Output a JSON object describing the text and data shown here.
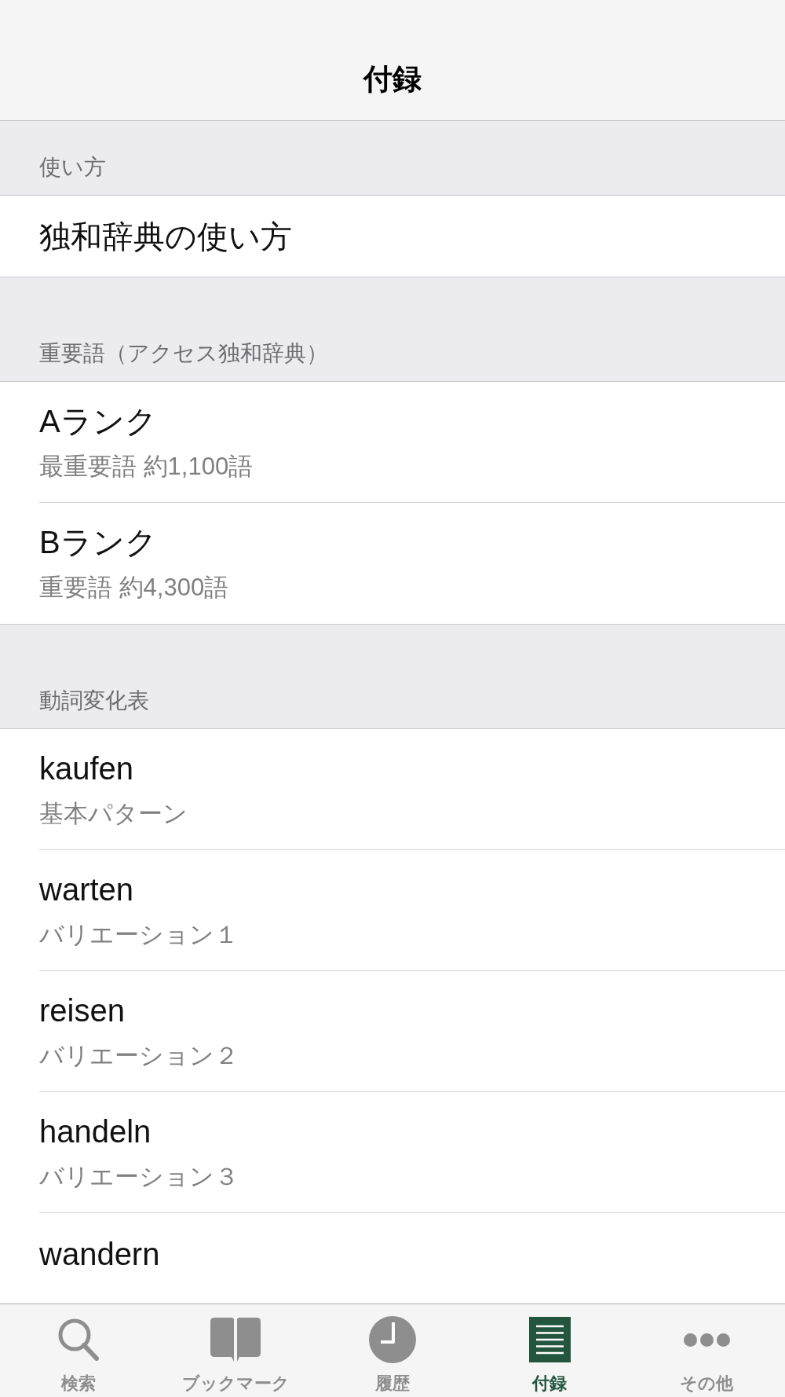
{
  "nav_bar": {
    "title": "付録"
  },
  "sections": [
    {
      "header": "使い方",
      "rows": [
        {
          "title": "独和辞典の使い方"
        }
      ]
    },
    {
      "header": "重要語（アクセス独和辞典）",
      "rows": [
        {
          "title": "Aランク",
          "subtitle": "最重要語 約1,100語"
        },
        {
          "title": "Bランク",
          "subtitle": "重要語 約4,300語"
        }
      ]
    },
    {
      "header": "動詞変化表",
      "rows": [
        {
          "title": "kaufen",
          "subtitle": "基本パターン"
        },
        {
          "title": "warten",
          "subtitle": "バリエーション１"
        },
        {
          "title": "reisen",
          "subtitle": "バリエーション２"
        },
        {
          "title": "handeln",
          "subtitle": "バリエーション３"
        },
        {
          "title": "wandern"
        }
      ]
    }
  ],
  "tab_bar": {
    "tabs": [
      {
        "kind": "search",
        "label": "検索",
        "selected": false
      },
      {
        "kind": "book",
        "label": "ブックマーク",
        "selected": false
      },
      {
        "kind": "clock",
        "label": "履歴",
        "selected": false
      },
      {
        "kind": "list",
        "label": "付録",
        "selected": true
      },
      {
        "kind": "more",
        "label": "その他",
        "selected": false
      }
    ]
  }
}
